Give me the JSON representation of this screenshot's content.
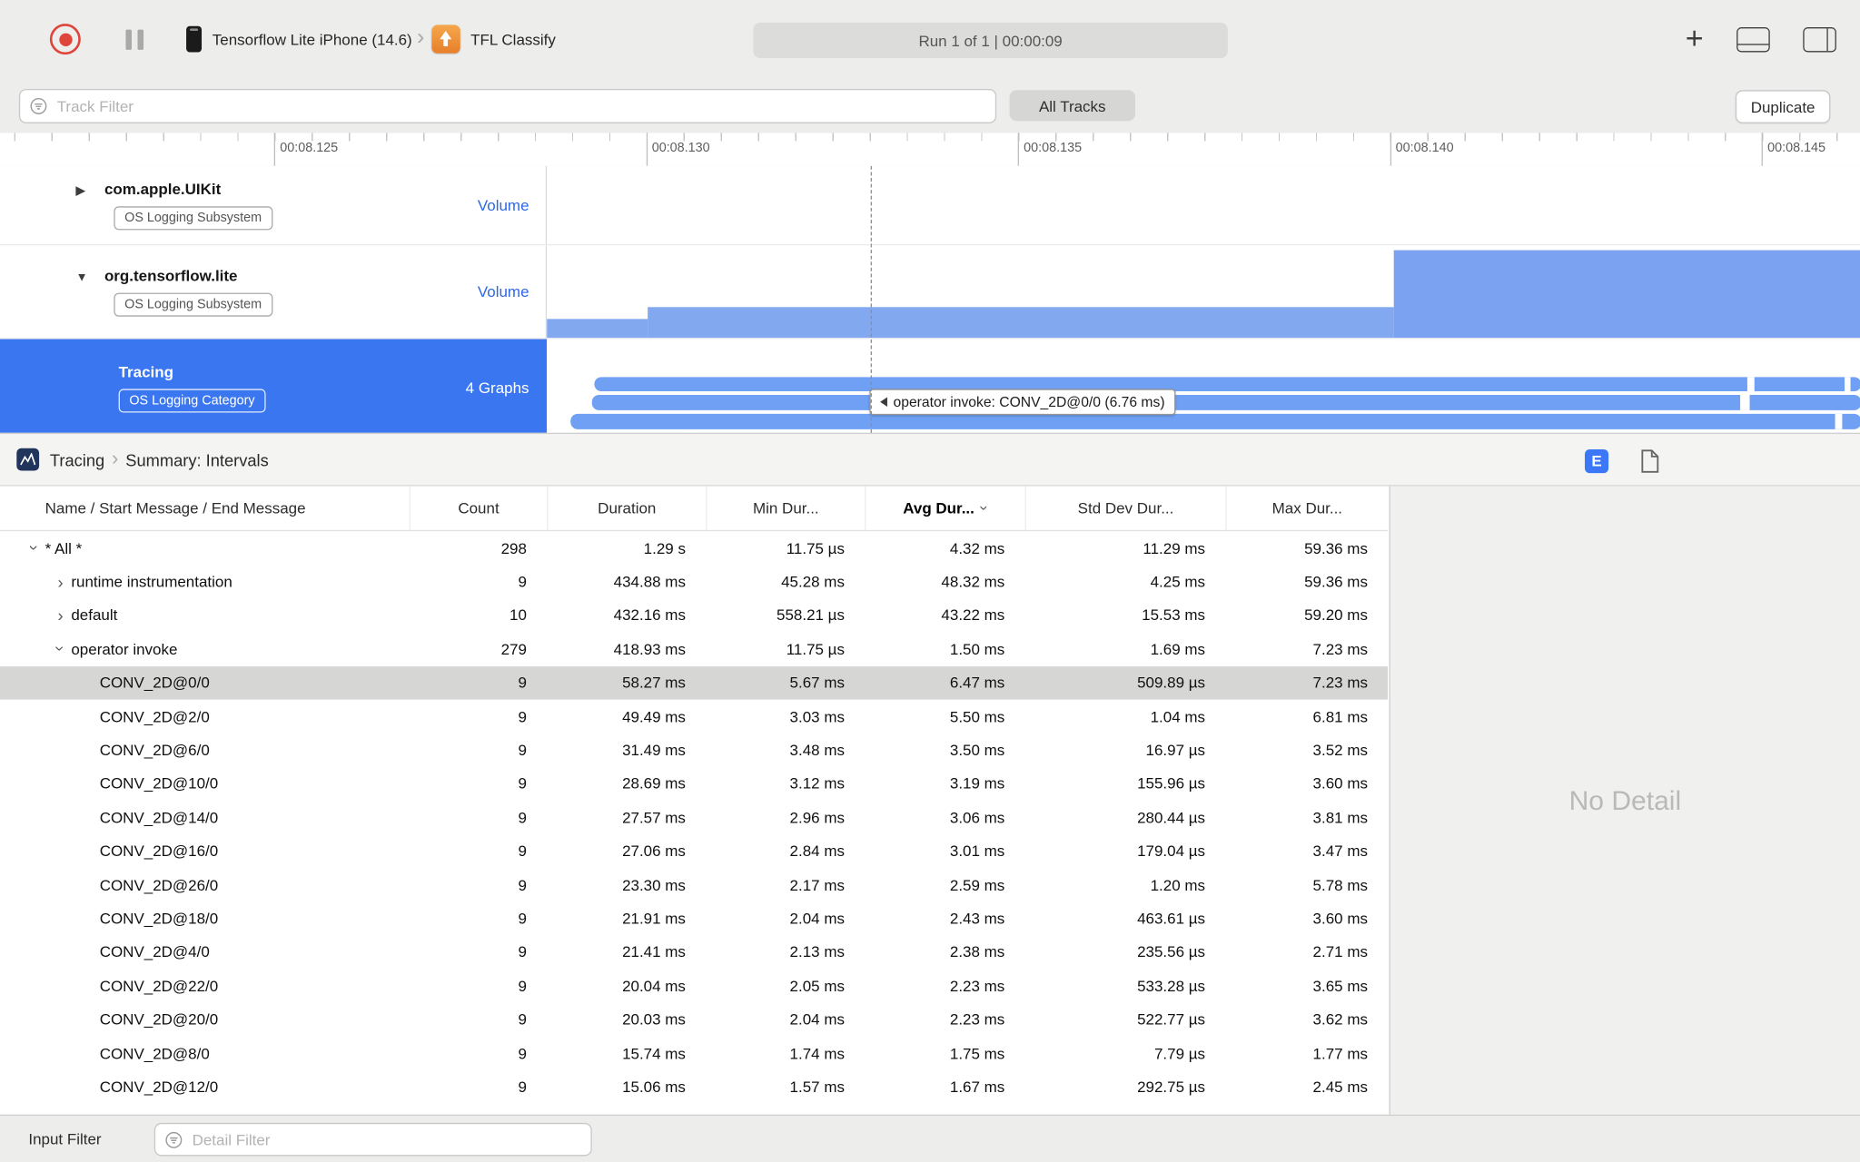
{
  "colors": {
    "accent_blue": "#3B76F1",
    "track_bar_blue": "#82A8F0",
    "interval_pill_blue": "#6FA0F4",
    "record_red": "#DE453B",
    "app_icon_orange": "#E87E2B",
    "selected_row_gray": "#D6D6D5"
  },
  "toolbar": {
    "device_name": "Tensorflow Lite iPhone (14.6)",
    "app_name": "TFL Classify",
    "run_status": "Run 1 of 1  |  00:00:09"
  },
  "filter_bar": {
    "track_filter_placeholder": "Track Filter",
    "all_tracks_label": "All Tracks",
    "duplicate_label": "Duplicate"
  },
  "ruler": {
    "tick_labels": [
      "00:08.125",
      "00:08.130",
      "00:08.135",
      "00:08.140",
      "00:08.145"
    ]
  },
  "tracks": [
    {
      "name": "com.apple.UIKit",
      "badge": "OS Logging Subsystem",
      "right_label": "Volume"
    },
    {
      "name": "org.tensorflow.lite",
      "badge": "OS Logging Subsystem",
      "right_label": "Volume"
    },
    {
      "name": "Tracing",
      "badge": "OS Logging Category",
      "right_label": "4 Graphs"
    }
  ],
  "track_tooltip": "operator invoke: CONV_2D@0/0 (6.76 ms)",
  "detail_header": {
    "breadcrumb_root": "Tracing",
    "breadcrumb_page": "Summary: Intervals",
    "editor_button_label": "E"
  },
  "table": {
    "columns": [
      "Name / Start Message / End Message",
      "Count",
      "Duration",
      "Min Dur...",
      "Avg Dur...",
      "Std Dev Dur...",
      "Max Dur..."
    ],
    "sorted_column": "Avg Dur...",
    "rows": [
      {
        "name": "* All *",
        "indent": 0,
        "disclosure": "open",
        "count": "298",
        "duration": "1.29 s",
        "min": "11.75 µs",
        "avg": "4.32 ms",
        "std": "11.29 ms",
        "max": "59.36 ms"
      },
      {
        "name": "runtime instrumentation",
        "indent": 1,
        "disclosure": "closed",
        "count": "9",
        "duration": "434.88 ms",
        "min": "45.28 ms",
        "avg": "48.32 ms",
        "std": "4.25 ms",
        "max": "59.36 ms"
      },
      {
        "name": "default",
        "indent": 1,
        "disclosure": "closed",
        "count": "10",
        "duration": "432.16 ms",
        "min": "558.21 µs",
        "avg": "43.22 ms",
        "std": "15.53 ms",
        "max": "59.20 ms"
      },
      {
        "name": "operator invoke",
        "indent": 1,
        "disclosure": "open",
        "count": "279",
        "duration": "418.93 ms",
        "min": "11.75 µs",
        "avg": "1.50 ms",
        "std": "1.69 ms",
        "max": "7.23 ms"
      },
      {
        "name": "CONV_2D@0/0",
        "indent": 2,
        "selected": true,
        "count": "9",
        "duration": "58.27 ms",
        "min": "5.67 ms",
        "avg": "6.47 ms",
        "std": "509.89 µs",
        "max": "7.23 ms"
      },
      {
        "name": "CONV_2D@2/0",
        "indent": 2,
        "count": "9",
        "duration": "49.49 ms",
        "min": "3.03 ms",
        "avg": "5.50 ms",
        "std": "1.04 ms",
        "max": "6.81 ms"
      },
      {
        "name": "CONV_2D@6/0",
        "indent": 2,
        "count": "9",
        "duration": "31.49 ms",
        "min": "3.48 ms",
        "avg": "3.50 ms",
        "std": "16.97 µs",
        "max": "3.52 ms"
      },
      {
        "name": "CONV_2D@10/0",
        "indent": 2,
        "count": "9",
        "duration": "28.69 ms",
        "min": "3.12 ms",
        "avg": "3.19 ms",
        "std": "155.96 µs",
        "max": "3.60 ms"
      },
      {
        "name": "CONV_2D@14/0",
        "indent": 2,
        "count": "9",
        "duration": "27.57 ms",
        "min": "2.96 ms",
        "avg": "3.06 ms",
        "std": "280.44 µs",
        "max": "3.81 ms"
      },
      {
        "name": "CONV_2D@16/0",
        "indent": 2,
        "count": "9",
        "duration": "27.06 ms",
        "min": "2.84 ms",
        "avg": "3.01 ms",
        "std": "179.04 µs",
        "max": "3.47 ms"
      },
      {
        "name": "CONV_2D@26/0",
        "indent": 2,
        "count": "9",
        "duration": "23.30 ms",
        "min": "2.17 ms",
        "avg": "2.59 ms",
        "std": "1.20 ms",
        "max": "5.78 ms"
      },
      {
        "name": "CONV_2D@18/0",
        "indent": 2,
        "count": "9",
        "duration": "21.91 ms",
        "min": "2.04 ms",
        "avg": "2.43 ms",
        "std": "463.61 µs",
        "max": "3.60 ms"
      },
      {
        "name": "CONV_2D@4/0",
        "indent": 2,
        "count": "9",
        "duration": "21.41 ms",
        "min": "2.13 ms",
        "avg": "2.38 ms",
        "std": "235.56 µs",
        "max": "2.71 ms"
      },
      {
        "name": "CONV_2D@22/0",
        "indent": 2,
        "count": "9",
        "duration": "20.04 ms",
        "min": "2.05 ms",
        "avg": "2.23 ms",
        "std": "533.28 µs",
        "max": "3.65 ms"
      },
      {
        "name": "CONV_2D@20/0",
        "indent": 2,
        "count": "9",
        "duration": "20.03 ms",
        "min": "2.04 ms",
        "avg": "2.23 ms",
        "std": "522.77 µs",
        "max": "3.62 ms"
      },
      {
        "name": "CONV_2D@8/0",
        "indent": 2,
        "count": "9",
        "duration": "15.74 ms",
        "min": "1.74 ms",
        "avg": "1.75 ms",
        "std": "7.79 µs",
        "max": "1.77 ms"
      },
      {
        "name": "CONV_2D@12/0",
        "indent": 2,
        "count": "9",
        "duration": "15.06 ms",
        "min": "1.57 ms",
        "avg": "1.67 ms",
        "std": "292.75 µs",
        "max": "2.45 ms"
      }
    ]
  },
  "detail_panel": {
    "empty_text": "No Detail"
  },
  "bottom_bar": {
    "input_filter_label": "Input Filter",
    "detail_filter_placeholder": "Detail Filter"
  }
}
